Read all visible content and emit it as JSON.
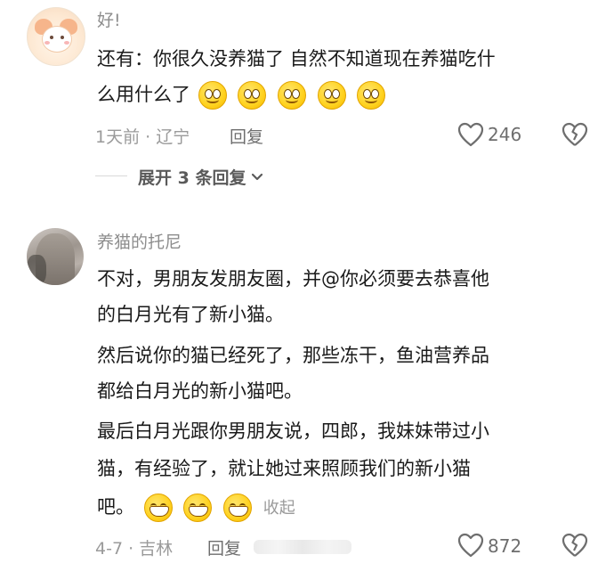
{
  "comments": [
    {
      "name": "好!",
      "lines": [
        "还有：你很久没养猫了 自然不知道现在养猫吃什",
        "么用什么了"
      ],
      "emoji_count": 5,
      "time_location": "1天前 · 辽宁",
      "reply_label": "回复",
      "likes": "246",
      "expand_label": "展开 3 条回复"
    },
    {
      "name": "养猫的托尼",
      "lines": [
        "不对，男朋友发朋友圈，并@你必须要去恭喜他",
        "的白月光有了新小猫。",
        "然后说你的猫已经死了，那些冻干，鱼油营养品",
        "都给白月光的新小猫吧。",
        "最后白月光跟你男朋友说，四郎，我妹妹带过小",
        "猫，有经验了，就让她过来照顾我们的新小猫",
        "吧。"
      ],
      "emoji_count": 3,
      "collapse_label": "收起",
      "time_location": "4-7 · 吉林",
      "reply_label": "回复",
      "likes": "872"
    }
  ],
  "icons": {
    "like": "heart-outline-icon",
    "dislike": "broken-heart-icon",
    "expand": "chevron-down-icon"
  }
}
